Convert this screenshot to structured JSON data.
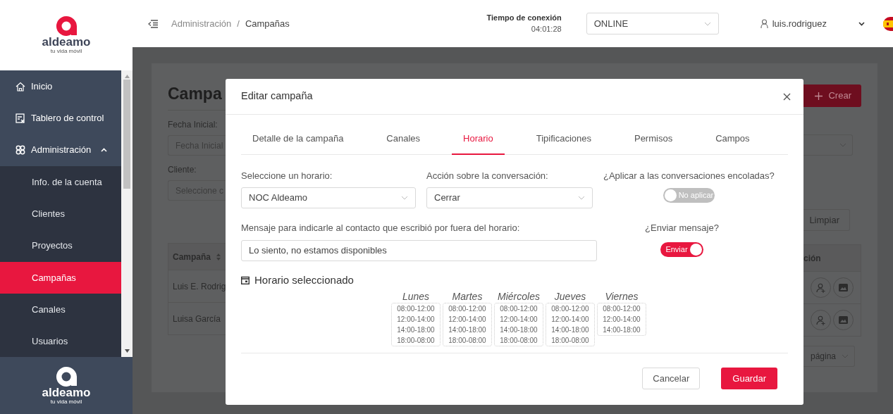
{
  "sidebar": {
    "logo": {
      "name": "aldeamo",
      "tagline": "tu vida móvil"
    },
    "items": [
      {
        "label": "Inicio",
        "selected": false
      },
      {
        "label": "Tablero de control",
        "selected": false
      },
      {
        "label": "Administración",
        "selected": false,
        "expanded": true,
        "children": [
          {
            "label": "Info. de la cuenta",
            "selected": false
          },
          {
            "label": "Clientes",
            "selected": false
          },
          {
            "label": "Proyectos",
            "selected": false
          },
          {
            "label": "Campañas",
            "selected": true
          },
          {
            "label": "Canales",
            "selected": false
          },
          {
            "label": "Usuarios",
            "selected": false
          }
        ]
      }
    ],
    "footer_logo": {
      "name": "aldeamo",
      "tagline": "tu vida móvil"
    }
  },
  "header": {
    "breadcrumb": [
      "Administración",
      "Campañas"
    ],
    "separator": "/",
    "connection": {
      "label": "Tiempo de conexión",
      "time": "04:01:28"
    },
    "status": "ONLINE",
    "user": "luis.rodriguez"
  },
  "page": {
    "title": "Campa",
    "create_button": "Crear",
    "fecha_label": "Fecha Inicial:",
    "fecha_placeholder": "Fecha Inicial",
    "cliente_label": "Cliente:",
    "cliente_placeholder": "Seleccione c",
    "clear_button": "Limpiar",
    "table": {
      "columns": [
        "Campaña",
        "ción"
      ],
      "rows": [
        [
          "Luis E. Rodrig"
        ],
        [
          "Luisa García"
        ]
      ]
    },
    "page_size": "página"
  },
  "modal": {
    "title": "Editar campaña",
    "tabs": [
      {
        "label": "Detalle de la campaña",
        "selected": false
      },
      {
        "label": "Canales",
        "selected": false
      },
      {
        "label": "Horario",
        "selected": true
      },
      {
        "label": "Tipificaciones",
        "selected": false
      },
      {
        "label": "Permisos",
        "selected": false
      },
      {
        "label": "Campos",
        "selected": false
      }
    ],
    "schedule": {
      "label": "Seleccione un horario:",
      "value": "NOC Aldeamo"
    },
    "action": {
      "label": "Acción sobre la conversación:",
      "value": "Cerrar"
    },
    "queued": {
      "label": "¿Aplicar a las conversaciones encoladas?",
      "toggle_label": "No aplicar",
      "on": false
    },
    "message": {
      "label": "Mensaje para indicarle al contacto que escribió por fuera del horario:",
      "value": "Lo siento, no estamos disponibles"
    },
    "send": {
      "label": "¿Enviar mensaje?",
      "toggle_label": "Enviar",
      "on": true
    },
    "selected_heading": "Horario seleccionado",
    "days": [
      {
        "name": "Lunes",
        "slots": [
          "08:00-12:00",
          "12:00-14:00",
          "14:00-18:00",
          "18:00-08:00"
        ]
      },
      {
        "name": "Martes",
        "slots": [
          "08:00-12:00",
          "12:00-14:00",
          "14:00-18:00",
          "18:00-08:00"
        ]
      },
      {
        "name": "Miércoles",
        "slots": [
          "08:00-12:00",
          "12:00-14:00",
          "14:00-18:00",
          "18:00-08:00"
        ]
      },
      {
        "name": "Jueves",
        "slots": [
          "08:00-12:00",
          "12:00-14:00",
          "14:00-18:00",
          "18:00-08:00"
        ]
      },
      {
        "name": "Viernes",
        "slots": [
          "08:00-12:00",
          "12:00-14:00",
          "14:00-18:00"
        ]
      }
    ],
    "cancel_button": "Cancelar",
    "save_button": "Guardar"
  }
}
